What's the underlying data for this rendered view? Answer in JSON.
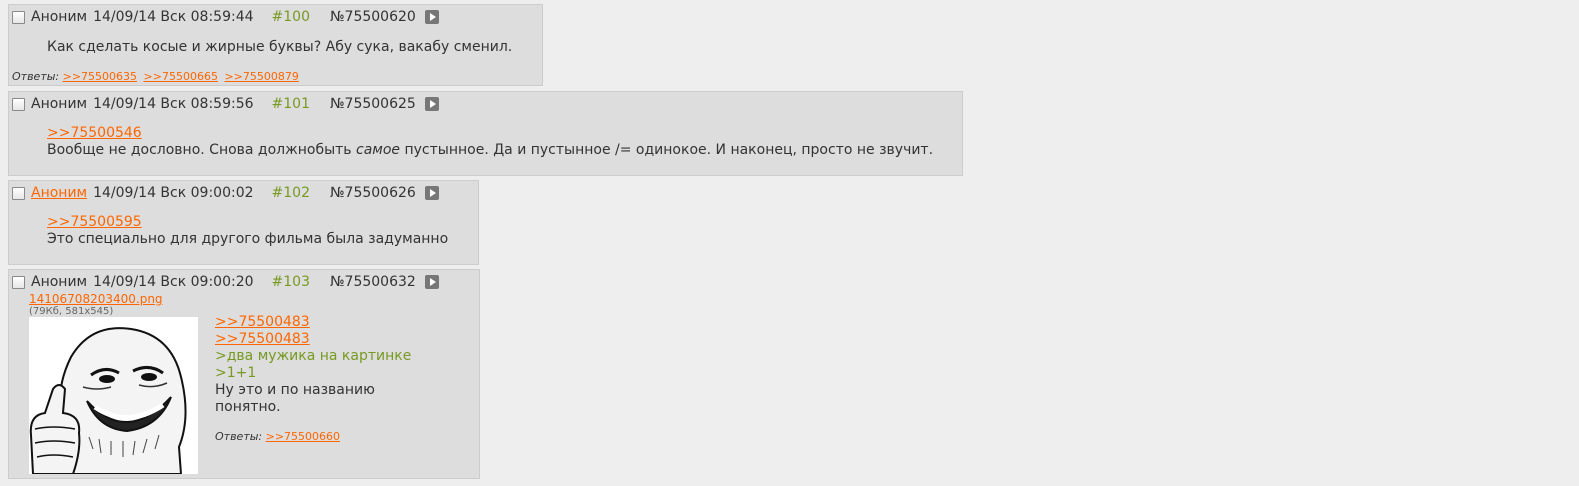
{
  "posts": [
    {
      "name": "Аноним",
      "date": "14/09/14 Вск 08:59:44",
      "num": "#100",
      "id": "№75500620",
      "message": "Как сделать косые и жирные буквы? Абу сука, вакабу сменил.",
      "replies_label": "Ответы:",
      "replies": [
        ">>75500635",
        ">>75500665",
        ">>75500879"
      ]
    },
    {
      "name": "Аноним",
      "date": "14/09/14 Вск 08:59:56",
      "num": "#101",
      "id": "№75500625",
      "reply_link": ">>75500546",
      "text_before": "Вообще не дословно. Снова должнобыть ",
      "text_italic": "самое",
      "text_after": " пустынное. Да и пустынное /= одинокое. И наконец, просто не звучит."
    },
    {
      "name": "Аноним",
      "date": "14/09/14 Вск 09:00:02",
      "num": "#102",
      "id": "№75500626",
      "reply_link": ">>75500595",
      "message": "Это специально для другого фильма была задуманно"
    },
    {
      "name": "Аноним",
      "date": "14/09/14 Вск 09:00:20",
      "num": "#103",
      "id": "№75500632",
      "file_name": "14106708203400.png",
      "file_info": "(79Кб, 581x545)",
      "links": [
        ">>75500483",
        ">>75500483"
      ],
      "quotes": [
        ">два мужика на картинке",
        ">1+1"
      ],
      "message_lines": [
        "Ну это и по названию",
        "понятно."
      ],
      "replies_label": "Ответы:",
      "replies": [
        ">>75500660"
      ]
    }
  ],
  "icons": {
    "checkbox": "checkbox-icon",
    "play": "play-icon"
  },
  "colors": {
    "background": "#eeeeee",
    "post_background": "#dddddd",
    "link": "#ff6600",
    "quote": "#789922"
  }
}
